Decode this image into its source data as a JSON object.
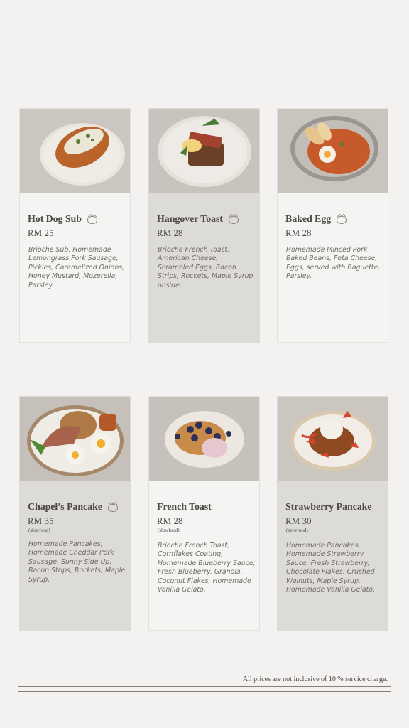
{
  "items": [
    {
      "name": "Hot Dog Sub",
      "price": "RM 25",
      "tag": "",
      "description": "Brioche Sub, Homemade Lemongrass Pork Sausage, Pickles, Caramelized Onions, Honey Mustard, Mozerella, Parsley.",
      "has_pork_icon": true
    },
    {
      "name": "Hangover Toast",
      "price": "RM 28",
      "tag": "",
      "description": "Brioche French Toast, American Cheese, Scrambled Eggs, Bacon Strips, Rockets, Maple Syrup onside.",
      "has_pork_icon": true
    },
    {
      "name": "Baked Egg",
      "price": "RM 28",
      "tag": "",
      "description": "Homemade Minced Pork Baked Beans, Feta Cheese, Eggs, served with Baguette, Parsley.",
      "has_pork_icon": true
    },
    {
      "name": "Chapel’s Pancake",
      "price": "RM 35",
      "tag": "(slowfood)",
      "description": "Homemade Pancakes, Homemade Cheddar Pork Sausage, Sunny Side Up, Bacon Strips, Rockets, Maple Syrup.",
      "has_pork_icon": true
    },
    {
      "name": "French Toast",
      "price": "RM 28",
      "tag": "(slowfood)",
      "description": "Brioche French Toast, Cornflakes Coating, Homemade Blueberry Sauce, Fresh Blueberry, Granola, Coconut Flakes, Homemade Vanilla Gelato.",
      "has_pork_icon": false
    },
    {
      "name": "Strawberry Pancake",
      "price": "RM 30",
      "tag": "(slowfood)",
      "description": "Homemade Pancakes, Homemade Strawberry Sauce, Fresh Strawberry, Chocolate Flakes, Crushed Walnuts, Maple Syrup, Homemade Vanilla Gelato.",
      "has_pork_icon": false
    }
  ],
  "footer": {
    "note": "All prices are not inclusive of 10 % service charge."
  },
  "colors": {
    "background": "#f3f2f1",
    "card_light": "#f4f4f3",
    "card_dark": "#dcdbd7",
    "rule": "#8a7f75"
  },
  "icons": [
    "pig-icon"
  ]
}
